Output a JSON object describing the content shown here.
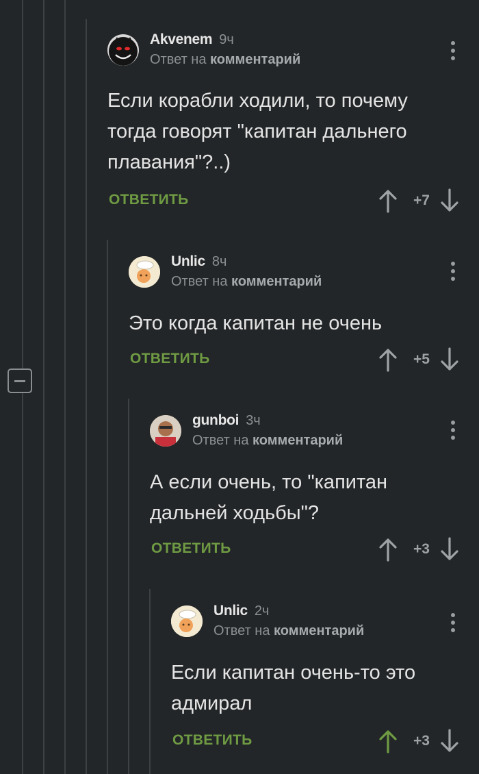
{
  "colors": {
    "background": "#232628",
    "reply_green": "#6f9b43",
    "upvote_active": "#6f9b43",
    "muted_text": "#8d9093"
  },
  "collapse": {
    "icon": "minus-icon"
  },
  "comments": [
    {
      "username": "Akvenem",
      "time": "9ч",
      "reply_prefix": "Ответ на",
      "reply_target": "комментарий",
      "text": "Если корабли ходили, то почему тогда говорят \"капитан дальнего плавания\"?..)",
      "reply_label": "ОТВЕТИТЬ",
      "score": "+7",
      "upvoted": false
    },
    {
      "username": "Unlic",
      "time": "8ч",
      "reply_prefix": "Ответ на",
      "reply_target": "комментарий",
      "text": "Это когда капитан не очень",
      "reply_label": "ОТВЕТИТЬ",
      "score": "+5",
      "upvoted": false
    },
    {
      "username": "gunboi",
      "time": "3ч",
      "reply_prefix": "Ответ на",
      "reply_target": "комментарий",
      "text": "А если очень, то \"капитан дальней ходьбы\"?",
      "reply_label": "ОТВЕТИТЬ",
      "score": "+3",
      "upvoted": false
    },
    {
      "username": "Unlic",
      "time": "2ч",
      "reply_prefix": "Ответ на",
      "reply_target": "комментарий",
      "text": "Если капитан очень-то это адмирал",
      "reply_label": "ОТВЕТИТЬ",
      "score": "+3",
      "upvoted": true
    }
  ]
}
